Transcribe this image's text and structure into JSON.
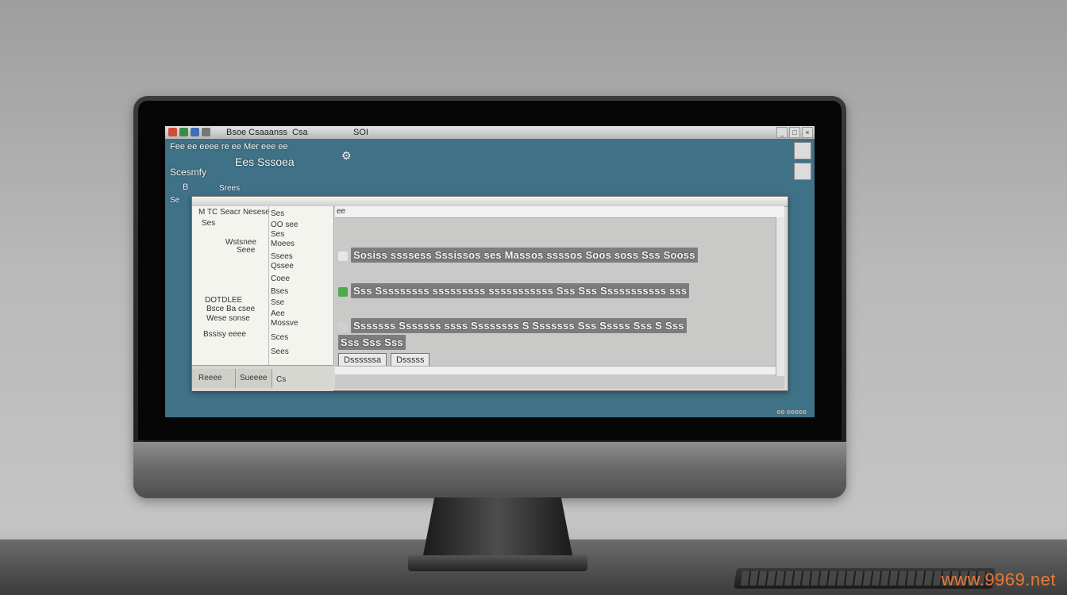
{
  "window": {
    "title_parts": [
      "Bsoe Csaaanss",
      "Csa",
      "SOI"
    ],
    "controls": [
      "_",
      "□",
      "×"
    ]
  },
  "header": {
    "line1": "Fee ee eeee re ee Mer eee ee",
    "line2": "Ees Sssoea",
    "line3": "Scesmfy",
    "line4": "B",
    "line5": "Srees",
    "line6": "Se"
  },
  "dialog": {
    "path": "ee",
    "left": {
      "labels": [
        "M TC Seacr Nesese",
        "Ses",
        "Wstsnee",
        "Seee",
        "DOTDLEE",
        "Bsce Ba csee",
        "Wese sonse",
        "Bssisy eeee"
      ],
      "dots": [
        "Ses",
        "OO see",
        "Ses",
        "Moees",
        "Ssees",
        "Qssee",
        "Coee",
        "Bses",
        "Sse",
        "Aee",
        "Mossve",
        "Sces",
        "Sees"
      ],
      "bottom": [
        "Reeee",
        "Sueeee",
        "Cs"
      ]
    },
    "rows": [
      "Sosiss ssssess Sssissos ses Massos ssssos Soos soss Sss Sooss",
      "Sss Sssssssss sssssssss sssssssssss Sss Sss Sssssssssss sss",
      "Sssssss Sssssss ssss Ssssssss S Sssssss Sss Sssss Sss S Sss",
      "Sss Sss Sss"
    ],
    "buttons": {
      "primary": "Dssssssa",
      "secondary": "Dsssss"
    }
  },
  "status": "ee eeeee"
}
